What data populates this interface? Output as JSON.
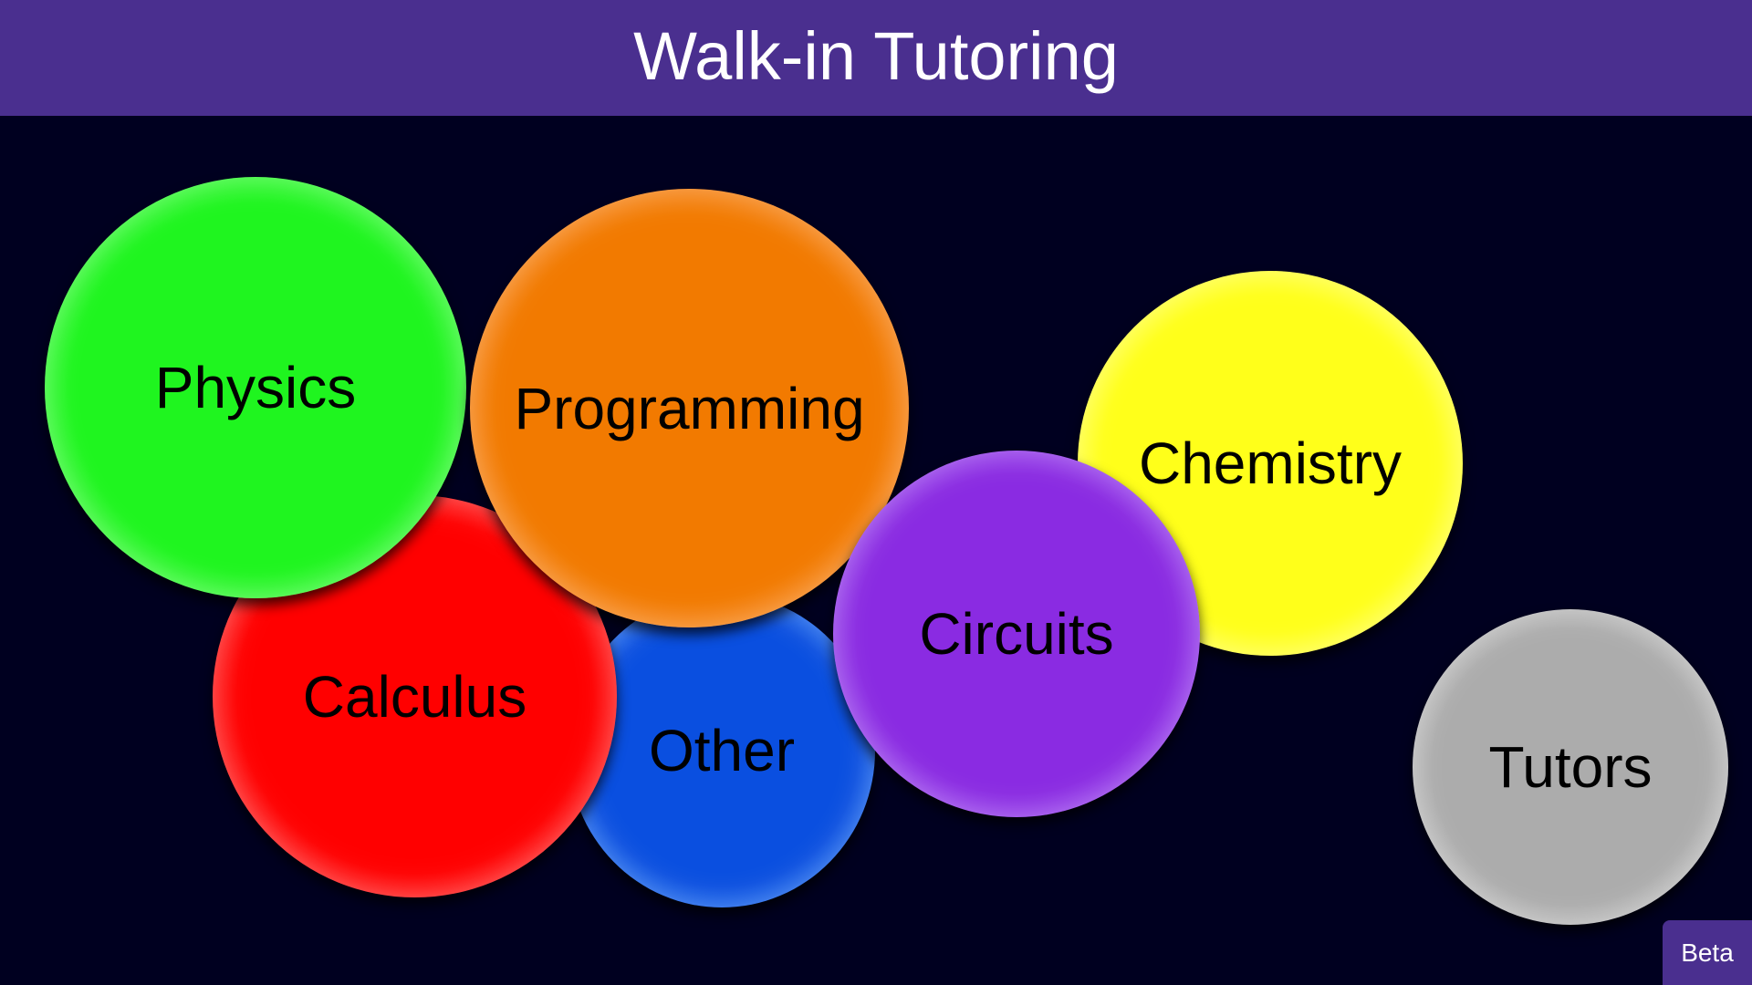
{
  "header": {
    "title": "Walk-in Tutoring"
  },
  "subjects": [
    {
      "id": "other",
      "label": "Other",
      "color": "#0a4fe0",
      "highlight": "#2a8cff"
    },
    {
      "id": "calculus",
      "label": "Calculus",
      "color": "#ff0000",
      "highlight": "#ff6a6a"
    },
    {
      "id": "physics",
      "label": "Physics",
      "color": "#1ff51f",
      "highlight": "#78ff78"
    },
    {
      "id": "programming",
      "label": "Programming",
      "color": "#f27a00",
      "highlight": "#ff9a50"
    },
    {
      "id": "chemistry",
      "label": "Chemistry",
      "color": "#ffff1a",
      "highlight": "#ffff90"
    },
    {
      "id": "circuits",
      "label": "Circuits",
      "color": "#8a2be2",
      "highlight": "#b070ff"
    },
    {
      "id": "tutors",
      "label": "Tutors",
      "color": "#acacac",
      "highlight": "#dedede"
    }
  ],
  "beta": {
    "label": "Beta"
  },
  "colors": {
    "header_bg": "#4a2f8f",
    "page_bg": "#000020"
  }
}
